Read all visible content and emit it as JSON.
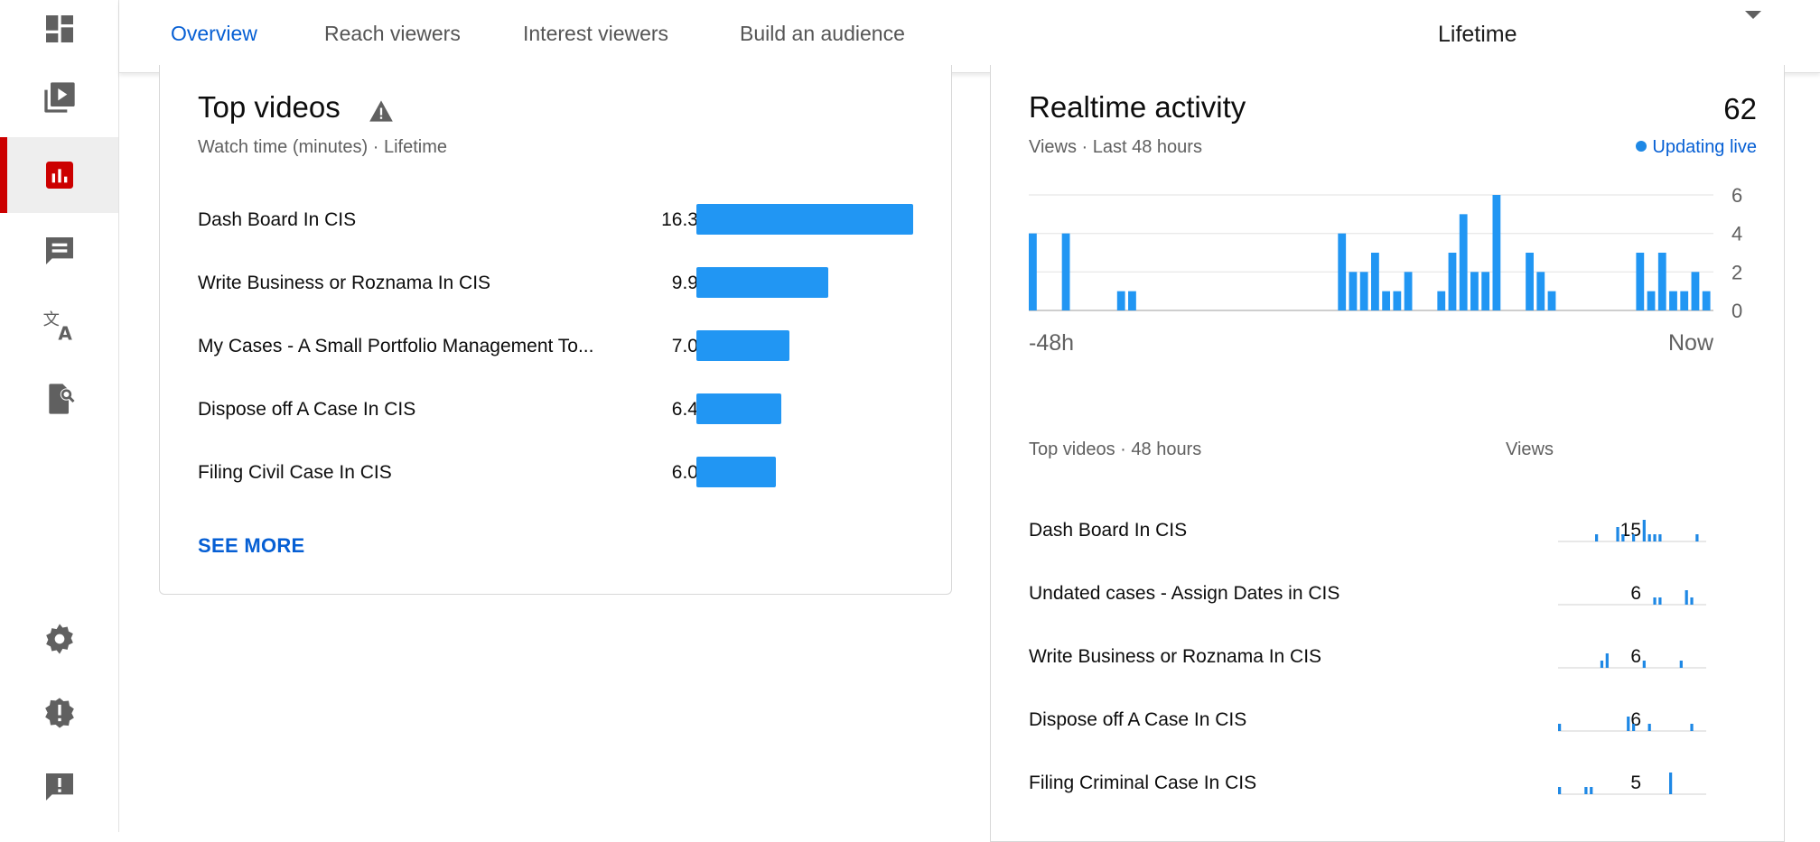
{
  "sidebar": {
    "items": [
      {
        "icon": "dashboard-icon",
        "active": false
      },
      {
        "icon": "content-icon",
        "active": false
      },
      {
        "icon": "analytics-icon",
        "active": true
      },
      {
        "icon": "comments-icon",
        "active": false
      },
      {
        "icon": "subtitles-icon",
        "active": false
      },
      {
        "icon": "copyright-icon",
        "active": false
      },
      {
        "icon": "settings-icon",
        "active": false
      },
      {
        "icon": "alert-icon",
        "active": false
      },
      {
        "icon": "feedback-icon",
        "active": false
      }
    ]
  },
  "tabs": [
    {
      "label": "Overview",
      "active": true
    },
    {
      "label": "Reach viewers",
      "active": false
    },
    {
      "label": "Interest viewers",
      "active": false
    },
    {
      "label": "Build an audience",
      "active": false
    }
  ],
  "period_selector": {
    "label": "Lifetime"
  },
  "top_videos": {
    "title": "Top videos",
    "subtitle": "Watch time (minutes) · Lifetime",
    "rows": [
      {
        "title": "Dash Board In CIS",
        "value": "16.3K",
        "amount": 16.3
      },
      {
        "title": "Write Business or Roznama In CIS",
        "value": "9.9K",
        "amount": 9.9
      },
      {
        "title": "My Cases - A Small Portfolio Management To...",
        "value": "7.0K",
        "amount": 7.0
      },
      {
        "title": "Dispose off A Case In CIS",
        "value": "6.4K",
        "amount": 6.4
      },
      {
        "title": "Filing Civil Case In CIS",
        "value": "6.0K",
        "amount": 6.0
      }
    ],
    "see_more_label": "SEE MORE"
  },
  "realtime": {
    "title": "Realtime activity",
    "total": "62",
    "subtitle": "Views · Last 48 hours",
    "live_label": "Updating live",
    "chart_start_label": "-48h",
    "chart_end_label": "Now",
    "table_header_left": "Top videos · 48 hours",
    "table_header_right": "Views",
    "rows": [
      {
        "title": "Dash Board In CIS",
        "views": "15",
        "spark": [
          0,
          0,
          0,
          0,
          0,
          0,
          0,
          1,
          0,
          0,
          0,
          2,
          1,
          0,
          1,
          0,
          3,
          1,
          1,
          1,
          0,
          0,
          0,
          0,
          0,
          0,
          1,
          0
        ]
      },
      {
        "title": "Undated cases - Assign Dates in CIS",
        "views": "6",
        "spark": [
          0,
          0,
          0,
          0,
          0,
          0,
          0,
          0,
          0,
          0,
          0,
          0,
          0,
          0,
          0,
          0,
          0,
          0,
          1,
          1,
          0,
          0,
          0,
          0,
          2,
          1,
          0,
          0
        ]
      },
      {
        "title": "Write Business or Roznama In CIS",
        "views": "6",
        "spark": [
          0,
          0,
          0,
          0,
          0,
          0,
          0,
          0,
          1,
          2,
          0,
          0,
          0,
          0,
          0,
          0,
          1,
          0,
          0,
          0,
          0,
          0,
          0,
          1,
          0,
          0,
          0,
          0
        ]
      },
      {
        "title": "Dispose off A Case In CIS",
        "views": "6",
        "spark": [
          1,
          0,
          0,
          0,
          0,
          0,
          0,
          0,
          0,
          0,
          0,
          0,
          0,
          2,
          1,
          0,
          0,
          1,
          0,
          0,
          0,
          0,
          0,
          0,
          0,
          1,
          0,
          0
        ]
      },
      {
        "title": "Filing Criminal Case In CIS",
        "views": "5",
        "spark": [
          1,
          0,
          0,
          0,
          0,
          1,
          1,
          0,
          0,
          0,
          0,
          0,
          0,
          0,
          0,
          0,
          0,
          0,
          0,
          0,
          0,
          3,
          0,
          0,
          0,
          0,
          0,
          0
        ]
      }
    ]
  },
  "chart_data": {
    "type": "bar",
    "title": "Realtime activity",
    "subtitle": "Views · Last 48 hours",
    "x_range_labels": [
      "-48h",
      "Now"
    ],
    "ylim": [
      0,
      6
    ],
    "yticks": [
      0,
      2,
      4,
      6
    ],
    "values": [
      4,
      0,
      0,
      4,
      0,
      0,
      0,
      0,
      1,
      1,
      0,
      0,
      0,
      0,
      0,
      0,
      0,
      0,
      0,
      0,
      0,
      0,
      0,
      0,
      0,
      0,
      0,
      0,
      4,
      2,
      2,
      3,
      1,
      1,
      2,
      0,
      0,
      1,
      3,
      5,
      2,
      2,
      6,
      0,
      0,
      3,
      2,
      1,
      0,
      0,
      0,
      0,
      0,
      0,
      0,
      3,
      1,
      3,
      1,
      1,
      2,
      1
    ],
    "color": "#2196f3"
  },
  "colors": {
    "accent": "#065fd4",
    "bar": "#2196f3",
    "active_indicator": "#cc0000"
  }
}
